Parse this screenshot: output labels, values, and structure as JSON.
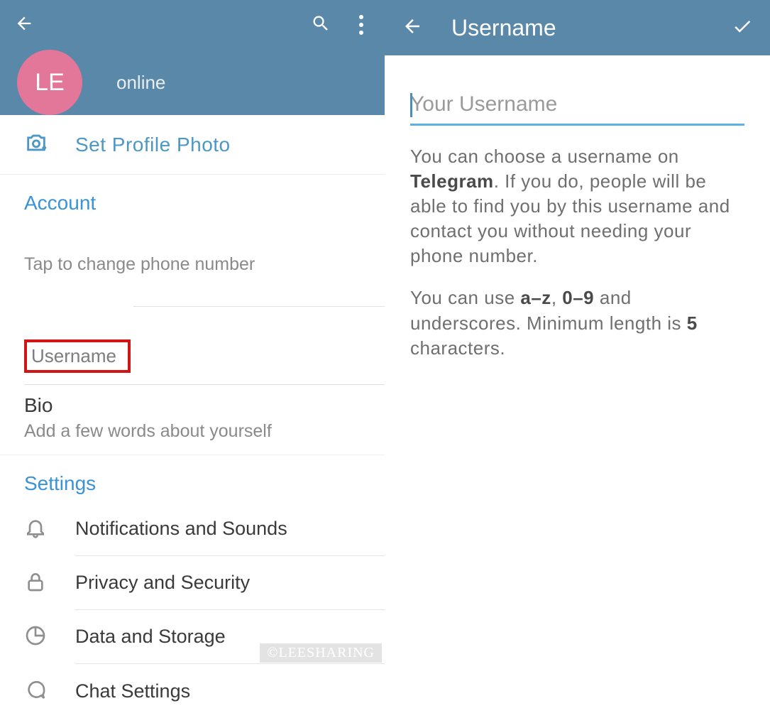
{
  "left": {
    "avatar_initials": "LE",
    "status": "online",
    "set_photo_label": "Set Profile Photo",
    "section_account": "Account",
    "tap_change_phone": "Tap to change phone number",
    "username_label": "Username",
    "bio_label": "Bio",
    "bio_hint": "Add a few words about yourself",
    "section_settings": "Settings",
    "items": [
      {
        "label": "Notifications and Sounds"
      },
      {
        "label": "Privacy and Security"
      },
      {
        "label": "Data and Storage"
      },
      {
        "label": "Chat Settings"
      }
    ],
    "watermark": "©LEESHARING"
  },
  "right": {
    "title": "Username",
    "input_placeholder": "Your Username",
    "help_p1_a": "You can choose a username on ",
    "help_p1_bold": "Telegram",
    "help_p1_b": ". If you do, people will be able to find you by this username and contact you without needing your phone number.",
    "help_p2_a": "You can use ",
    "help_p2_b1": "a–z",
    "help_p2_mid": ", ",
    "help_p2_b2": "0–9",
    "help_p2_c": " and underscores. Minimum length is ",
    "help_p2_b3": "5",
    "help_p2_d": " characters."
  }
}
